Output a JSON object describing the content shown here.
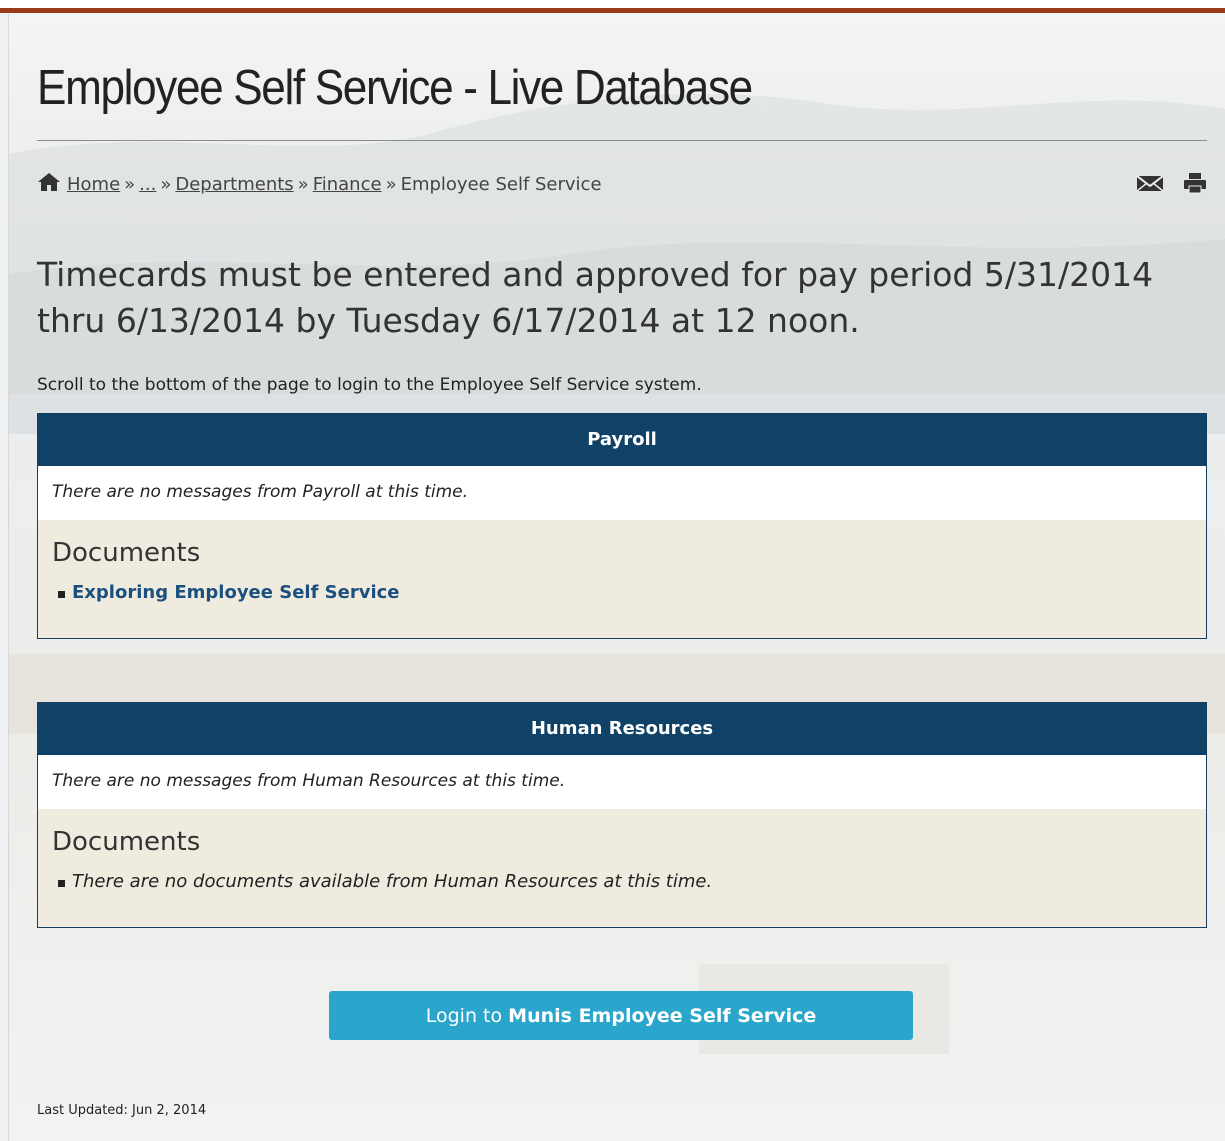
{
  "page": {
    "title": "Employee Self Service - Live Database"
  },
  "breadcrumb": {
    "items": [
      {
        "label": "Home"
      },
      {
        "label": "..."
      },
      {
        "label": "Departments"
      },
      {
        "label": "Finance"
      }
    ],
    "current": "Employee Self Service",
    "separator": "»"
  },
  "tools": {
    "email_icon": "envelope-icon",
    "print_icon": "printer-icon"
  },
  "notice": "Timecards must be entered and approved for pay period 5/31/2014 thru 6/13/2014 by Tuesday 6/17/2014 at 12 noon.",
  "intro": "Scroll to the bottom of the page to login to the Employee Self Service system.",
  "panels": [
    {
      "title": "Payroll",
      "message": "There are no messages from Payroll at this time.",
      "docs_heading": "Documents",
      "doc": "Exploring Employee Self Service"
    },
    {
      "title": "Human Resources",
      "message": "There are no messages from Human Resources at this time.",
      "docs_heading": "Documents",
      "doc": "There are no documents available from Human Resources at this time."
    }
  ],
  "login": {
    "prefix": "Login to",
    "strong": "Munis Employee Self Service"
  },
  "footer": {
    "last_updated": "Last Updated: Jun 2, 2014"
  },
  "colors": {
    "accent_bar": "#9a3a1d",
    "panel_header": "#0f4266",
    "panel_body": "#efebdf",
    "login_button": "#2aa6cd",
    "doc_link": "#1b4f7d"
  }
}
